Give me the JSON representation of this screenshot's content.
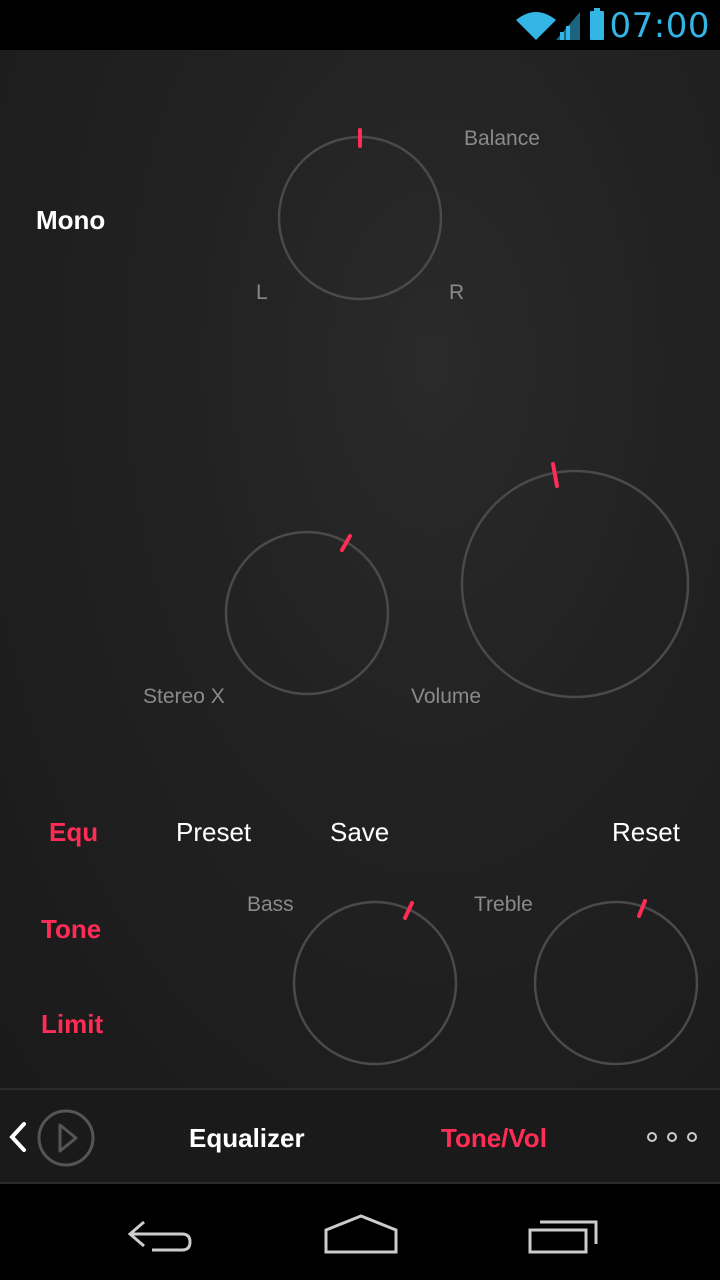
{
  "status_bar": {
    "time": "07:00",
    "icons": [
      "wifi-icon",
      "signal-icon",
      "battery-icon"
    ],
    "accent_color": "#33b5e5"
  },
  "main": {
    "mode_label": "Mono",
    "balance": {
      "label": "Balance",
      "left": "L",
      "right": "R"
    },
    "stereo_x": {
      "label": "Stereo X"
    },
    "volume": {
      "label": "Volume"
    },
    "menu": {
      "preset": "Preset",
      "save": "Save",
      "reset": "Reset"
    },
    "side_tabs": [
      "Equ",
      "Tone",
      "Limit"
    ],
    "tone": {
      "bass_label": "Bass",
      "treble_label": "Treble"
    },
    "accent_color": "#ff2d55"
  },
  "tabbar": {
    "equalizer": "Equalizer",
    "tone_vol": "Tone/Vol",
    "icons": [
      "chevron-left-icon",
      "play-icon",
      "more-icon"
    ]
  },
  "navbar": {
    "icons": [
      "back-icon",
      "home-icon",
      "recents-icon"
    ]
  }
}
